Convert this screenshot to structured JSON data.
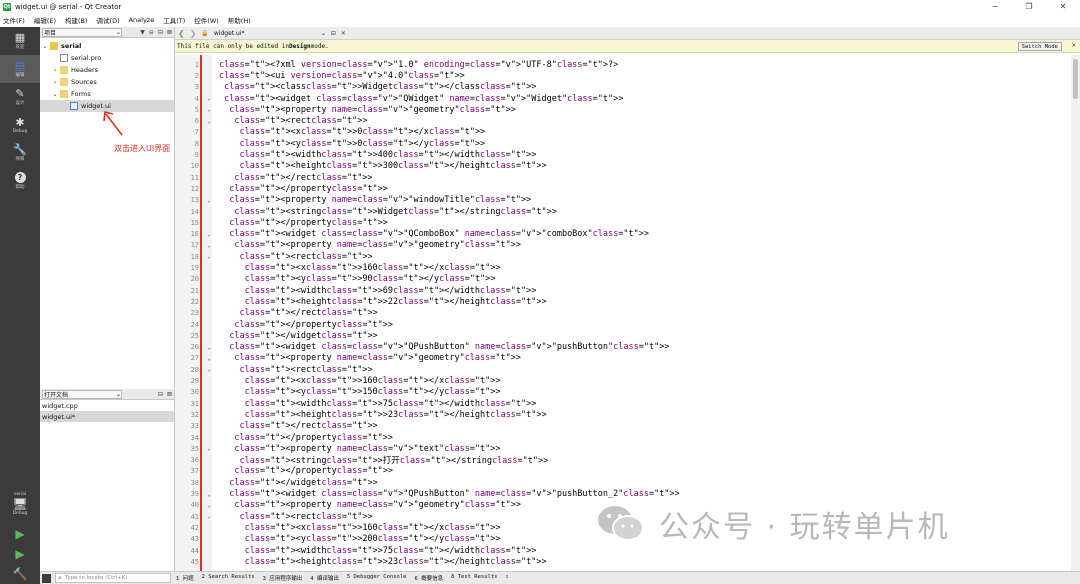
{
  "window": {
    "title": "widget.ui @ serial - Qt Creator",
    "minimize": "─",
    "maximize": "❐",
    "close": "✕"
  },
  "menubar": [
    "文件(F)",
    "编辑(E)",
    "构建(B)",
    "调试(D)",
    "Analyze",
    "工具(T)",
    "控件(W)",
    "帮助(H)"
  ],
  "modes": [
    {
      "label": "欢迎",
      "icon": "grid-icon"
    },
    {
      "label": "编辑",
      "icon": "edit-icon",
      "active": true
    },
    {
      "label": "设计",
      "icon": "pencil-icon"
    },
    {
      "label": "Debug",
      "icon": "bug-icon"
    },
    {
      "label": "项目",
      "icon": "wrench-icon"
    },
    {
      "label": "帮助",
      "icon": "help-icon"
    }
  ],
  "kit": {
    "project": "serial",
    "config": "Debug"
  },
  "navigator": {
    "view_label": "项目",
    "tree": [
      {
        "label": "serial",
        "depth": 0,
        "arrow": "⌄",
        "icon": "proj",
        "bold": true
      },
      {
        "label": "serial.pro",
        "depth": 1,
        "arrow": "",
        "icon": "pro"
      },
      {
        "label": "Headers",
        "depth": 1,
        "arrow": "›",
        "icon": "folder"
      },
      {
        "label": "Sources",
        "depth": 1,
        "arrow": "›",
        "icon": "folder"
      },
      {
        "label": "Forms",
        "depth": 1,
        "arrow": "⌄",
        "icon": "folder"
      },
      {
        "label": "widget.ui",
        "depth": 2,
        "arrow": "",
        "icon": "ui",
        "selected": true
      }
    ],
    "annotation": "双击进入UI界面"
  },
  "open_docs": {
    "label": "打开文档",
    "files": [
      {
        "label": "widget.cpp",
        "selected": false
      },
      {
        "label": "widget.ui*",
        "selected": true
      }
    ]
  },
  "editor": {
    "doc_name": "widget.ui*",
    "info_prefix": "This file can only be edited in ",
    "info_bold": "Design",
    "info_suffix": " mode.",
    "switch_mode": "Switch Mode"
  },
  "code_lines": [
    {
      "n": 1,
      "f": "",
      "text": "<?xml version=\"1.0\" encoding=\"UTF-8\"?>"
    },
    {
      "n": 2,
      "f": "",
      "text": "<ui version=\"4.0\">"
    },
    {
      "n": 3,
      "f": "",
      "text": " <class>Widget</class>"
    },
    {
      "n": 4,
      "f": "⌄",
      "text": " <widget class=\"QWidget\" name=\"Widget\">"
    },
    {
      "n": 5,
      "f": "⌄",
      "text": "  <property name=\"geometry\">"
    },
    {
      "n": 6,
      "f": "⌄",
      "text": "   <rect>"
    },
    {
      "n": 7,
      "f": "",
      "text": "    <x>0</x>"
    },
    {
      "n": 8,
      "f": "",
      "text": "    <y>0</y>"
    },
    {
      "n": 9,
      "f": "",
      "text": "    <width>400</width>"
    },
    {
      "n": 10,
      "f": "",
      "text": "    <height>300</height>"
    },
    {
      "n": 11,
      "f": "",
      "text": "   </rect>"
    },
    {
      "n": 12,
      "f": "",
      "text": "  </property>"
    },
    {
      "n": 13,
      "f": "⌄",
      "text": "  <property name=\"windowTitle\">"
    },
    {
      "n": 14,
      "f": "",
      "text": "   <string>Widget</string>"
    },
    {
      "n": 15,
      "f": "",
      "text": "  </property>"
    },
    {
      "n": 16,
      "f": "⌄",
      "text": "  <widget class=\"QComboBox\" name=\"comboBox\">"
    },
    {
      "n": 17,
      "f": "⌄",
      "text": "   <property name=\"geometry\">"
    },
    {
      "n": 18,
      "f": "⌄",
      "text": "    <rect>"
    },
    {
      "n": 19,
      "f": "",
      "text": "     <x>160</x>"
    },
    {
      "n": 20,
      "f": "",
      "text": "     <y>90</y>"
    },
    {
      "n": 21,
      "f": "",
      "text": "     <width>69</width>"
    },
    {
      "n": 22,
      "f": "",
      "text": "     <height>22</height>"
    },
    {
      "n": 23,
      "f": "",
      "text": "    </rect>"
    },
    {
      "n": 24,
      "f": "",
      "text": "   </property>"
    },
    {
      "n": 25,
      "f": "",
      "text": "  </widget>"
    },
    {
      "n": 26,
      "f": "⌄",
      "text": "  <widget class=\"QPushButton\" name=\"pushButton\">"
    },
    {
      "n": 27,
      "f": "⌄",
      "text": "   <property name=\"geometry\">"
    },
    {
      "n": 28,
      "f": "⌄",
      "text": "    <rect>"
    },
    {
      "n": 29,
      "f": "",
      "text": "     <x>160</x>"
    },
    {
      "n": 30,
      "f": "",
      "text": "     <y>150</y>"
    },
    {
      "n": 31,
      "f": "",
      "text": "     <width>75</width>"
    },
    {
      "n": 32,
      "f": "",
      "text": "     <height>23</height>"
    },
    {
      "n": 33,
      "f": "",
      "text": "    </rect>"
    },
    {
      "n": 34,
      "f": "",
      "text": "   </property>"
    },
    {
      "n": 35,
      "f": "⌄",
      "text": "   <property name=\"text\">"
    },
    {
      "n": 36,
      "f": "",
      "text": "    <string>打开</string>"
    },
    {
      "n": 37,
      "f": "",
      "text": "   </property>"
    },
    {
      "n": 38,
      "f": "",
      "text": "  </widget>"
    },
    {
      "n": 39,
      "f": "⌄",
      "text": "  <widget class=\"QPushButton\" name=\"pushButton_2\">"
    },
    {
      "n": 40,
      "f": "⌄",
      "text": "   <property name=\"geometry\">"
    },
    {
      "n": 41,
      "f": "⌄",
      "text": "    <rect>"
    },
    {
      "n": 42,
      "f": "",
      "text": "     <x>160</x>"
    },
    {
      "n": 43,
      "f": "",
      "text": "     <y>200</y>"
    },
    {
      "n": 44,
      "f": "",
      "text": "     <width>75</width>"
    },
    {
      "n": 45,
      "f": "",
      "text": "     <height>23</height>"
    }
  ],
  "statusbar": {
    "locator_placeholder": "Type to locate (Ctrl+K)",
    "tabs": [
      "1 问题",
      "2 Search Results",
      "3 应用程序输出",
      "4 编译输出",
      "5 Debugger Console",
      "6 概要信息",
      "8 Test Results",
      "⇕"
    ]
  },
  "watermark": {
    "text": "公众号 · 玩转单片机"
  },
  "colors": {
    "tag": "#808000",
    "attr": "#800080",
    "value": "#008000",
    "annotation": "#e0301e",
    "sidebar": "#3b3b3b"
  }
}
